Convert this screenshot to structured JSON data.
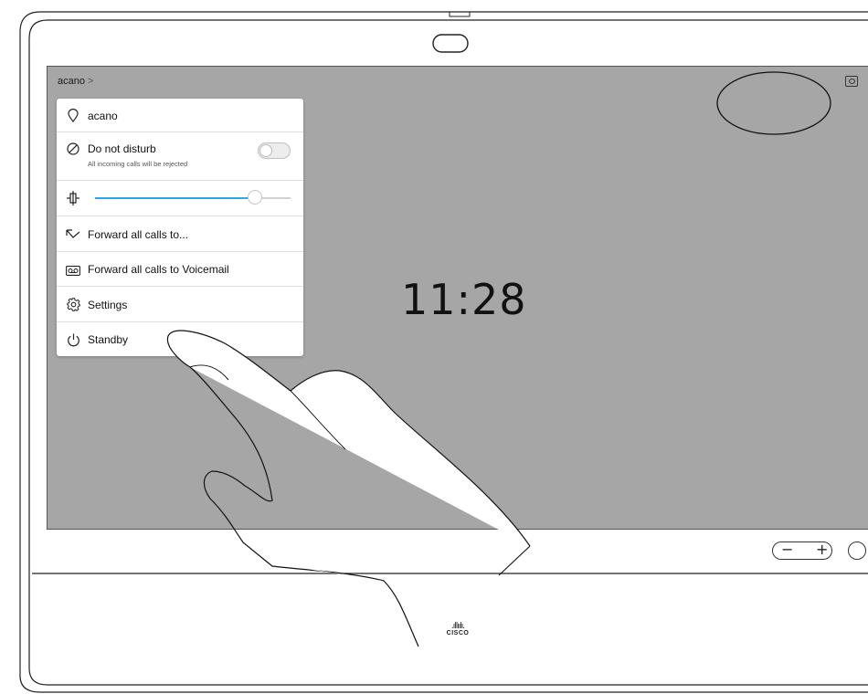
{
  "header": {
    "breadcrumb": "acano",
    "breadcrumb_chevron": ">",
    "selfview_icon": "selfview-icon"
  },
  "clock": "11:28",
  "menu": {
    "items": [
      {
        "label": "acano",
        "icon": "location-pin-icon"
      },
      {
        "label": "Do not disturb",
        "sublabel": "All incoming calls will be rejected",
        "icon": "do-not-disturb-icon",
        "toggle_on": false
      },
      {
        "label": "",
        "icon": "brightness-icon",
        "slider_fraction": 0.82
      },
      {
        "label": "Forward all calls to...",
        "icon": "forward-arrow-icon"
      },
      {
        "label": "Forward all calls to Voicemail",
        "icon": "voicemail-icon"
      },
      {
        "label": "Settings",
        "icon": "gear-icon"
      },
      {
        "label": "Standby",
        "icon": "power-icon"
      }
    ]
  },
  "hardware": {
    "volume_minus": "−",
    "volume_plus": "+",
    "brand": "CISCO",
    "brand_bars": ".ıllıılı."
  },
  "colors": {
    "screen_bg": "#a6a6a6",
    "slider_accent": "#2aa8e8",
    "menu_bg": "#ffffff"
  }
}
